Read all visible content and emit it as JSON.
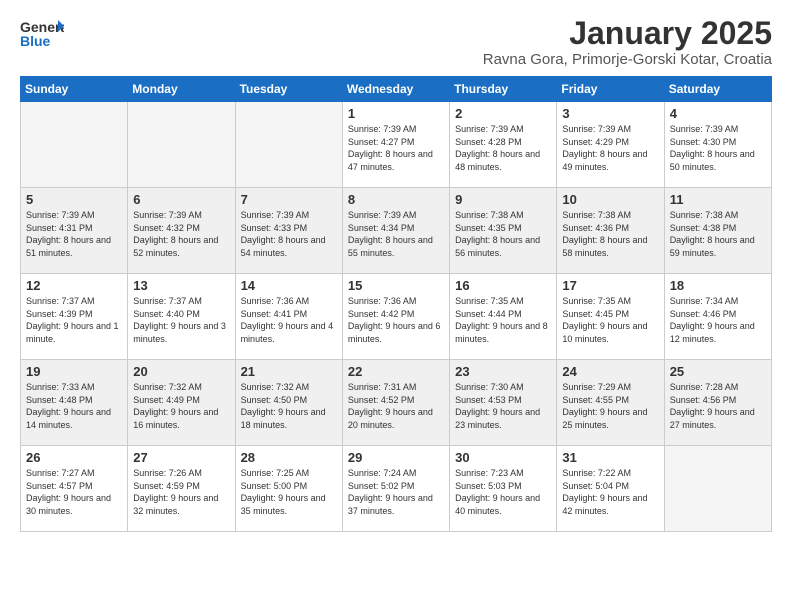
{
  "header": {
    "logo_general": "General",
    "logo_blue": "Blue",
    "month": "January 2025",
    "location": "Ravna Gora, Primorje-Gorski Kotar, Croatia"
  },
  "weekdays": [
    "Sunday",
    "Monday",
    "Tuesday",
    "Wednesday",
    "Thursday",
    "Friday",
    "Saturday"
  ],
  "weeks": [
    [
      {
        "day": "",
        "info": ""
      },
      {
        "day": "",
        "info": ""
      },
      {
        "day": "",
        "info": ""
      },
      {
        "day": "1",
        "info": "Sunrise: 7:39 AM\nSunset: 4:27 PM\nDaylight: 8 hours and 47 minutes."
      },
      {
        "day": "2",
        "info": "Sunrise: 7:39 AM\nSunset: 4:28 PM\nDaylight: 8 hours and 48 minutes."
      },
      {
        "day": "3",
        "info": "Sunrise: 7:39 AM\nSunset: 4:29 PM\nDaylight: 8 hours and 49 minutes."
      },
      {
        "day": "4",
        "info": "Sunrise: 7:39 AM\nSunset: 4:30 PM\nDaylight: 8 hours and 50 minutes."
      }
    ],
    [
      {
        "day": "5",
        "info": "Sunrise: 7:39 AM\nSunset: 4:31 PM\nDaylight: 8 hours and 51 minutes."
      },
      {
        "day": "6",
        "info": "Sunrise: 7:39 AM\nSunset: 4:32 PM\nDaylight: 8 hours and 52 minutes."
      },
      {
        "day": "7",
        "info": "Sunrise: 7:39 AM\nSunset: 4:33 PM\nDaylight: 8 hours and 54 minutes."
      },
      {
        "day": "8",
        "info": "Sunrise: 7:39 AM\nSunset: 4:34 PM\nDaylight: 8 hours and 55 minutes."
      },
      {
        "day": "9",
        "info": "Sunrise: 7:38 AM\nSunset: 4:35 PM\nDaylight: 8 hours and 56 minutes."
      },
      {
        "day": "10",
        "info": "Sunrise: 7:38 AM\nSunset: 4:36 PM\nDaylight: 8 hours and 58 minutes."
      },
      {
        "day": "11",
        "info": "Sunrise: 7:38 AM\nSunset: 4:38 PM\nDaylight: 8 hours and 59 minutes."
      }
    ],
    [
      {
        "day": "12",
        "info": "Sunrise: 7:37 AM\nSunset: 4:39 PM\nDaylight: 9 hours and 1 minute."
      },
      {
        "day": "13",
        "info": "Sunrise: 7:37 AM\nSunset: 4:40 PM\nDaylight: 9 hours and 3 minutes."
      },
      {
        "day": "14",
        "info": "Sunrise: 7:36 AM\nSunset: 4:41 PM\nDaylight: 9 hours and 4 minutes."
      },
      {
        "day": "15",
        "info": "Sunrise: 7:36 AM\nSunset: 4:42 PM\nDaylight: 9 hours and 6 minutes."
      },
      {
        "day": "16",
        "info": "Sunrise: 7:35 AM\nSunset: 4:44 PM\nDaylight: 9 hours and 8 minutes."
      },
      {
        "day": "17",
        "info": "Sunrise: 7:35 AM\nSunset: 4:45 PM\nDaylight: 9 hours and 10 minutes."
      },
      {
        "day": "18",
        "info": "Sunrise: 7:34 AM\nSunset: 4:46 PM\nDaylight: 9 hours and 12 minutes."
      }
    ],
    [
      {
        "day": "19",
        "info": "Sunrise: 7:33 AM\nSunset: 4:48 PM\nDaylight: 9 hours and 14 minutes."
      },
      {
        "day": "20",
        "info": "Sunrise: 7:32 AM\nSunset: 4:49 PM\nDaylight: 9 hours and 16 minutes."
      },
      {
        "day": "21",
        "info": "Sunrise: 7:32 AM\nSunset: 4:50 PM\nDaylight: 9 hours and 18 minutes."
      },
      {
        "day": "22",
        "info": "Sunrise: 7:31 AM\nSunset: 4:52 PM\nDaylight: 9 hours and 20 minutes."
      },
      {
        "day": "23",
        "info": "Sunrise: 7:30 AM\nSunset: 4:53 PM\nDaylight: 9 hours and 23 minutes."
      },
      {
        "day": "24",
        "info": "Sunrise: 7:29 AM\nSunset: 4:55 PM\nDaylight: 9 hours and 25 minutes."
      },
      {
        "day": "25",
        "info": "Sunrise: 7:28 AM\nSunset: 4:56 PM\nDaylight: 9 hours and 27 minutes."
      }
    ],
    [
      {
        "day": "26",
        "info": "Sunrise: 7:27 AM\nSunset: 4:57 PM\nDaylight: 9 hours and 30 minutes."
      },
      {
        "day": "27",
        "info": "Sunrise: 7:26 AM\nSunset: 4:59 PM\nDaylight: 9 hours and 32 minutes."
      },
      {
        "day": "28",
        "info": "Sunrise: 7:25 AM\nSunset: 5:00 PM\nDaylight: 9 hours and 35 minutes."
      },
      {
        "day": "29",
        "info": "Sunrise: 7:24 AM\nSunset: 5:02 PM\nDaylight: 9 hours and 37 minutes."
      },
      {
        "day": "30",
        "info": "Sunrise: 7:23 AM\nSunset: 5:03 PM\nDaylight: 9 hours and 40 minutes."
      },
      {
        "day": "31",
        "info": "Sunrise: 7:22 AM\nSunset: 5:04 PM\nDaylight: 9 hours and 42 minutes."
      },
      {
        "day": "",
        "info": ""
      }
    ]
  ]
}
